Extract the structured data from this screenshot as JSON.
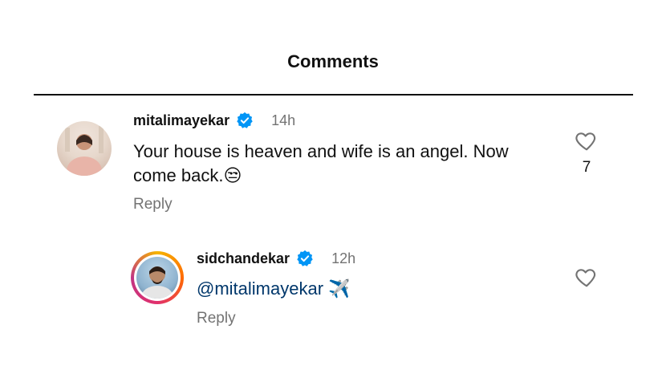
{
  "header": {
    "title": "Comments"
  },
  "comments": [
    {
      "username": "mitalimayekar",
      "timestamp": "14h",
      "text_line1": "Your house is heaven and wife is an angel. Now",
      "text_line2": "come back.",
      "emoji": "😒",
      "reply_label": "Reply",
      "like_count": "7",
      "verified": true
    },
    {
      "username": "sidchandekar",
      "timestamp": "12h",
      "mention": "@mitalimayekar",
      "emoji": "✈️",
      "reply_label": "Reply",
      "verified": true
    }
  ],
  "colors": {
    "verified_badge": "#0095f6",
    "mention": "#00376b",
    "muted": "#737373"
  },
  "icons": {
    "verified": "verified-badge-icon",
    "like": "heart-outline-icon"
  }
}
